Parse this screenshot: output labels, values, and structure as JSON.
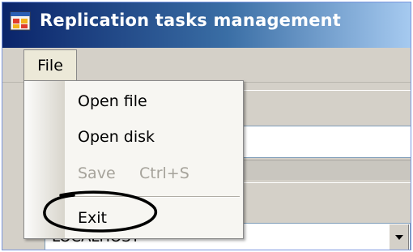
{
  "window": {
    "title": "Replication tasks management",
    "icon": "app-window-icon"
  },
  "menubar": {
    "file_label": "File"
  },
  "file_menu": {
    "items": [
      {
        "label": "Open file",
        "enabled": true
      },
      {
        "label": "Open disk",
        "enabled": true
      },
      {
        "label": "Save",
        "shortcut": "Ctrl+S",
        "enabled": false
      },
      {
        "label": "Exit",
        "enabled": true
      }
    ]
  },
  "form": {
    "server_combo": {
      "value": "LOCALHOST",
      "dropdown_icon": "chevron-down-icon"
    }
  },
  "annotation": {
    "shape": "hand-drawn-ellipse",
    "target": "Exit",
    "color": "#000000"
  },
  "colors": {
    "titlebar_start": "#0a246a",
    "titlebar_end": "#a6caf0",
    "disabled_text": "#a6a39b"
  }
}
